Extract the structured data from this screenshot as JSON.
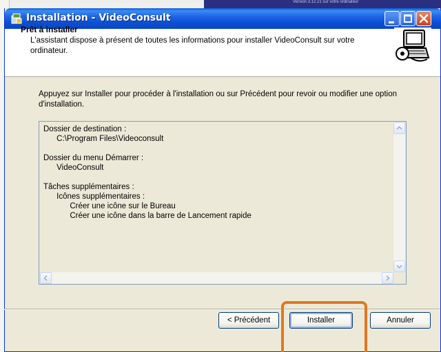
{
  "background": {
    "version_text": "Version 3.12.21 sur votre ordinateur"
  },
  "window": {
    "title": "Installation - VideoConsult",
    "controls": {
      "minimize": "minimize-icon",
      "maximize": "maximize-icon",
      "close": "close-icon"
    }
  },
  "header": {
    "title": "Prêt à installer",
    "description": "L'assistant dispose à présent de toutes les informations pour installer VideoConsult sur votre ordinateur."
  },
  "instruction": "Appuyez sur Installer pour procéder à l'installation ou sur Précédent pour revoir ou modifier une option d'installation.",
  "memo": {
    "lines": [
      "Dossier de destination :",
      "      C:\\Program Files\\Videoconsult",
      "",
      "Dossier du menu Démarrer :",
      "      VideoConsult",
      "",
      "Tâches supplémentaires :",
      "      Icônes supplémentaires :",
      "            Créer une icône sur le Bureau",
      "            Créer une icône dans la barre de Lancement rapide"
    ]
  },
  "buttons": {
    "back": "< Précédent",
    "install": "Installer",
    "cancel": "Annuler"
  },
  "colors": {
    "titlebar": "#0b4fd4",
    "highlight": "#e07820"
  }
}
